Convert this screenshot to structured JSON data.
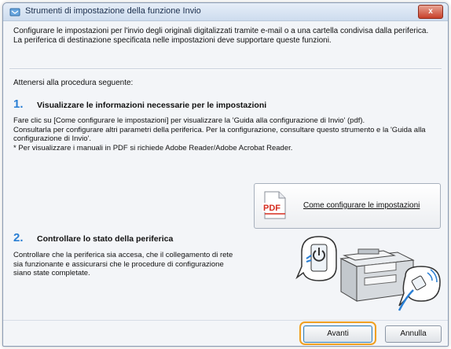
{
  "window": {
    "title": "Strumenti di impostazione della funzione Invio",
    "close_label": "x"
  },
  "intro": {
    "line1": "Configurare le impostazioni per l'invio degli originali digitalizzati tramite e-mail o a una cartella condivisa dalla periferica.",
    "line2": "La periferica di destinazione specificata nelle impostazioni deve supportare queste funzioni."
  },
  "procedure_label": "Attenersi alla procedura seguente:",
  "step1": {
    "number": "1.",
    "title": "Visualizzare le informazioni necessarie per le impostazioni",
    "desc1": "Fare clic su [Come configurare le impostazioni] per visualizzare la 'Guida alla configurazione di Invio' (pdf).",
    "desc2": "Consultarla per configurare altri parametri della periferica. Per la configurazione, consultare questo strumento e la 'Guida alla configurazione di Invio'.",
    "desc3": "* Per visualizzare i manuali in PDF si richiede Adobe Reader/Adobe Acrobat Reader."
  },
  "howto_button": {
    "icon_text": "PDF",
    "label": "Come configurare le impostazioni"
  },
  "step2": {
    "number": "2.",
    "title": "Controllare lo stato della periferica",
    "desc": "Controllare che la periferica sia accesa, che il collegamento di rete sia funzionante e assicurarsi che le procedure di configurazione siano state completate."
  },
  "buttons": {
    "next": "Avanti",
    "cancel": "Annulla"
  },
  "colors": {
    "step_number": "#2a7fd4",
    "highlight": "#f0a020",
    "pdf_red": "#d52b1e"
  }
}
